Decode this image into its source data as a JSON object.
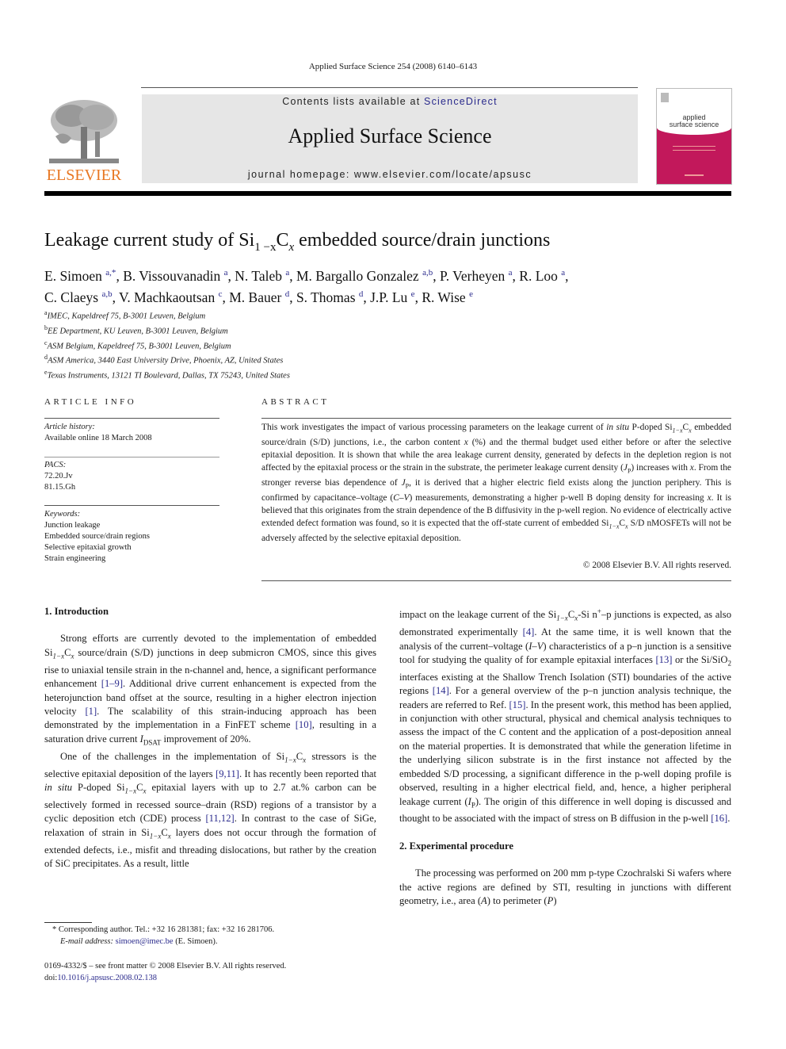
{
  "running_head": "Applied Surface Science 254 (2008) 6140–6143",
  "header": {
    "publisher_logo_text": "ELSEVIER",
    "contents_prefix": "Contents lists available at ",
    "contents_link": "ScienceDirect",
    "journal_title": "Applied Surface Science",
    "homepage_prefix": "journal homepage: ",
    "homepage_url": "www.elsevier.com/locate/apsusc",
    "cover_title_line1": "applied",
    "cover_title_line2": "surface science",
    "colors": {
      "elsevier_orange": "#e87722",
      "cover_magenta": "#c2185b",
      "link_blue": "#2a2a8c",
      "banner_gray": "#e6e6e6"
    }
  },
  "article": {
    "title_prefix": "Leakage current study of Si",
    "title_sub1": "1 −x",
    "title_mid": "C",
    "title_sub2": "x",
    "title_suffix": " embedded source/drain junctions",
    "authors": [
      {
        "name": "E. Simoen",
        "aff": "a,*"
      },
      {
        "name": "B. Vissouvanadin",
        "aff": "a"
      },
      {
        "name": "N. Taleb",
        "aff": "a"
      },
      {
        "name": "M. Bargallo Gonzalez",
        "aff": "a,b"
      },
      {
        "name": "P. Verheyen",
        "aff": "a"
      },
      {
        "name": "R. Loo",
        "aff": "a"
      },
      {
        "name": "C. Claeys",
        "aff": "a,b"
      },
      {
        "name": "V. Machkaoutsan",
        "aff": "c"
      },
      {
        "name": "M. Bauer",
        "aff": "d"
      },
      {
        "name": "S. Thomas",
        "aff": "d"
      },
      {
        "name": "J.P. Lu",
        "aff": "e"
      },
      {
        "name": "R. Wise",
        "aff": "e"
      }
    ],
    "affiliations": [
      {
        "key": "a",
        "text": "IMEC, Kapeldreef 75, B-3001 Leuven, Belgium"
      },
      {
        "key": "b",
        "text": "EE Department, KU Leuven, B-3001 Leuven, Belgium"
      },
      {
        "key": "c",
        "text": "ASM Belgium, Kapeldreef 75, B-3001 Leuven, Belgium"
      },
      {
        "key": "d",
        "text": "ASM America, 3440 East University Drive, Phoenix, AZ, United States"
      },
      {
        "key": "e",
        "text": "Texas Instruments, 13121 TI Boulevard, Dallas, TX 75243, United States"
      }
    ]
  },
  "article_info": {
    "heading": "ARTICLE INFO",
    "history_label": "Article history:",
    "history_value": "Available online 18 March 2008",
    "pacs_label": "PACS:",
    "pacs": [
      "72.20.Jv",
      "81.15.Gh"
    ],
    "keywords_label": "Keywords:",
    "keywords": [
      "Junction leakage",
      "Embedded source/drain regions",
      "Selective epitaxial growth",
      "Strain engineering"
    ]
  },
  "abstract": {
    "heading": "ABSTRACT",
    "s1": "This work investigates the impact of various processing parameters on the leakage current of ",
    "s1_em": "in situ",
    "s2": " P-doped Si",
    "s3": " embedded source/drain (S/D) junctions, i.e., the carbon content ",
    "s4": " (%) and the thermal budget used either before or after the selective epitaxial deposition. It is shown that while the area leakage current density, generated by defects in the depletion region is not affected by the epitaxial process or the strain in the substrate, the perimeter leakage current density (",
    "s5": ") increases with ",
    "s6": ". From the stronger reverse bias dependence of ",
    "s7": ", it is derived that a higher electric field exists along the junction periphery. This is confirmed by capacitance–voltage (",
    "s7_em": "C–V",
    "s8": ") measurements, demonstrating a higher p-well B doping density for increasing ",
    "s9": ". It is believed that this originates from the strain dependence of the B diffusivity in the p-well region. No evidence of electrically active extended defect formation was found, so it is expected that the off-state current of embedded Si",
    "s10": " S/D nMOSFETs will not be adversely affected by the selective epitaxial deposition.",
    "copyright": "© 2008 Elsevier B.V. All rights reserved."
  },
  "sections": {
    "intro_heading": "1.  Introduction",
    "p1": {
      "a": "Strong efforts are currently devoted to the implementation of embedded Si",
      "b": " source/drain (S/D) junctions in deep submicron CMOS, since this gives rise to uniaxial tensile strain in the n-channel and, hence, a significant performance enhancement ",
      "c1": "[1–9]",
      "d": ". Additional drive current enhancement is expected from the heterojunction band offset at the source, resulting in a higher electron injection velocity ",
      "c2": "[1]",
      "e": ". The scalability of this strain-inducing approach has been demonstrated by the implementation in a FinFET scheme ",
      "c3": "[10]",
      "f": ", resulting in a saturation drive current ",
      "g": " improvement of 20%."
    },
    "p2": {
      "a": "One of the challenges in the implementation of Si",
      "b": " stressors is the selective epitaxial deposition of the layers ",
      "c1": "[9,11]",
      "d": ". It has recently been reported that ",
      "em": "in situ",
      "e": " P-doped Si",
      "f": " epitaxial layers with up to 2.7 at.% carbon can be selectively formed in recessed source–drain (RSD) regions of a transistor by a cyclic deposition etch (CDE) process ",
      "c2": "[11,12]",
      "g": ". In contrast to the case of SiGe, relaxation of strain in Si",
      "h": " layers does not occur through the formation of extended defects, i.e., misfit and threading dislocations, but rather by the creation of SiC precipitates. As a result, little"
    },
    "p3": {
      "a": "impact on the leakage current of the Si",
      "b": "-Si n",
      "c": "–p junctions is expected, as also demonstrated experimentally ",
      "c1": "[4]",
      "d": ". At the same time, it is well known that the analysis of the current–voltage (",
      "em": "I–V",
      "e": ") characteristics of a p–n junction is a sensitive tool for studying the quality of for example epitaxial interfaces ",
      "c2": "[13]",
      "f": " or the Si/SiO",
      "g": " interfaces existing at the Shallow Trench Isolation (STI) boundaries of the active regions ",
      "c3": "[14]",
      "h": ". For a general overview of the p–n junction analysis technique, the readers are referred to Ref. ",
      "c4": "[15]",
      "i": ". In the present work, this method has been applied, in conjunction with other structural, physical and chemical analysis techniques to assess the impact of the C content and the application of a post-deposition anneal on the material properties. It is demonstrated that while the generation lifetime in the underlying silicon substrate is in the first instance not affected by the embedded S/D processing, a significant difference in the p-well doping profile is observed, resulting in a higher electrical field, and, hence, a higher peripheral leakage current (",
      "j": "). The origin of this difference in well doping is discussed and thought to be associated with the impact of stress on B diffusion in the p-well ",
      "c5": "[16]",
      "k": "."
    },
    "exp_heading": "2.  Experimental procedure",
    "p4": {
      "a": "The processing was performed on 200 mm p-type Czochralski Si wafers where the active regions are defined by STI, resulting in junctions with different geometry, i.e., area (",
      "b": ") to perimeter (",
      "c": ")"
    }
  },
  "symbols": {
    "sub_1mx": "1−x",
    "sub_x": "x",
    "C": "C",
    "x": "x",
    "J": "J",
    "I": "I",
    "sub_P": "P",
    "sub_DSAT": "DSAT",
    "sup_plus": "+",
    "sub_2": "2",
    "A": "A",
    "P": "P"
  },
  "footnotes": {
    "marker": "*",
    "corresponding": " Corresponding author. Tel.: +32 16 281381; fax: +32 16 281706.",
    "email_label": "E-mail address:",
    "email": "simoen@imec.be",
    "email_suffix": " (E. Simoen).",
    "issn_line": "0169-4332/$ – see front matter © 2008 Elsevier B.V. All rights reserved.",
    "doi_prefix": "doi:",
    "doi": "10.1016/j.apsusc.2008.02.138"
  }
}
